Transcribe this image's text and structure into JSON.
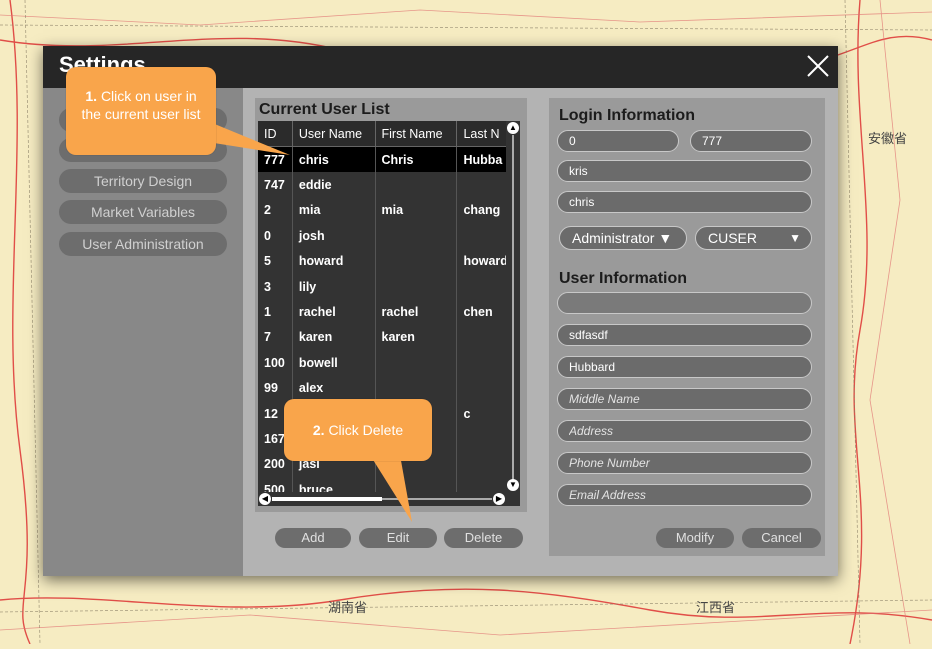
{
  "map": {
    "labels": [
      "安徽省",
      "湖南省",
      "江西省"
    ]
  },
  "dialog": {
    "title": "Settings",
    "close_label": "×"
  },
  "nav": {
    "items": [
      {
        "label": ""
      },
      {
        "label": ""
      },
      {
        "label": "Territory Design"
      },
      {
        "label": "Market Variables"
      },
      {
        "label": "User Administration"
      }
    ]
  },
  "user_list": {
    "title": "Current User List",
    "columns": [
      "ID",
      "User Name",
      "First Name",
      "Last N"
    ],
    "rows": [
      {
        "id": "777",
        "username": "chris",
        "first": "Chris",
        "last": "Hubba"
      },
      {
        "id": "747",
        "username": "eddie",
        "first": "",
        "last": ""
      },
      {
        "id": "2",
        "username": "mia",
        "first": "mia",
        "last": "chang"
      },
      {
        "id": "0",
        "username": "josh",
        "first": "",
        "last": ""
      },
      {
        "id": "5",
        "username": "howard",
        "first": "",
        "last": "howard"
      },
      {
        "id": "3",
        "username": "lily",
        "first": "",
        "last": ""
      },
      {
        "id": "1",
        "username": "rachel",
        "first": "rachel",
        "last": "chen"
      },
      {
        "id": "7",
        "username": "karen",
        "first": "karen",
        "last": ""
      },
      {
        "id": "100",
        "username": "bowell",
        "first": "",
        "last": ""
      },
      {
        "id": "99",
        "username": "alex",
        "first": "",
        "last": ""
      },
      {
        "id": "12",
        "username": "",
        "first": "",
        "last": "c"
      },
      {
        "id": "167",
        "username": "",
        "first": "",
        "last": ""
      },
      {
        "id": "200",
        "username": "jasi",
        "first": "",
        "last": ""
      },
      {
        "id": "500",
        "username": "bruce",
        "first": "",
        "last": ""
      }
    ],
    "buttons": {
      "add": "Add",
      "edit": "Edit",
      "delete": "Delete"
    }
  },
  "login_info": {
    "title": "Login Information",
    "field1": "0",
    "field2": "777",
    "field3": "kris",
    "field4": "chris",
    "role": "Administrator ▼",
    "group": "CUSER",
    "group_caret": "▼"
  },
  "user_info": {
    "title": "User Information",
    "field1": "",
    "first_name": "sdfasdf",
    "last_name": "Hubbard",
    "middle_placeholder": "Middle Name",
    "address_placeholder": "Address",
    "phone_placeholder": "Phone Number",
    "email_placeholder": "Email Address"
  },
  "actions": {
    "modify": "Modify",
    "cancel": "Cancel"
  },
  "callouts": {
    "step1_num": "1.",
    "step1_text": "Click on user in the current user list",
    "step2_num": "2.",
    "step2_text": "Click Delete"
  },
  "colors": {
    "callout": "#f9a54b",
    "titlebar": "#262626",
    "panel": "#9a9a9a"
  }
}
